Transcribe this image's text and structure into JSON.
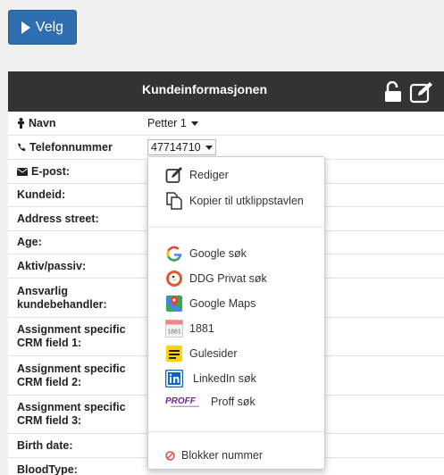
{
  "toolbar": {
    "velg_label": "Velg"
  },
  "panel": {
    "title": "Kundeinformasjonen"
  },
  "fields": {
    "navn": {
      "label": "Navn",
      "value": "Petter 1"
    },
    "telefon": {
      "label": "Telefonnummer",
      "value": "47714710"
    },
    "epost": {
      "label": "E-post:"
    },
    "kundeid": {
      "label": "Kundeid:"
    },
    "address": {
      "label": "Address street:"
    },
    "age": {
      "label": "Age:"
    },
    "aktiv": {
      "label": "Aktiv/passiv:"
    },
    "ansvarlig": {
      "label": "Ansvarlig kundebehandler:"
    },
    "crm1": {
      "label": "Assignment specific CRM field 1:"
    },
    "crm2": {
      "label": "Assignment specific CRM field 2:"
    },
    "crm3": {
      "label": "Assignment specific CRM field 3:"
    },
    "birth": {
      "label": "Birth date:"
    },
    "blood": {
      "label": "BloodType:"
    }
  },
  "menu": {
    "rediger": "Rediger",
    "kopier": "Kopier til utklippstavlen",
    "google": "Google søk",
    "ddg": "DDG Privat søk",
    "maps": "Google Maps",
    "n1881": "1881",
    "gulesider": "Gulesider",
    "linkedin": "LinkedIn søk",
    "proff": "Proff søk",
    "blokker": "Blokker nummer",
    "icon_1881_text": "1881",
    "icon_proff_text": "PROFF"
  },
  "colors": {
    "primary": "#2f6fb1",
    "header": "#333333",
    "block": "#d9534f"
  }
}
